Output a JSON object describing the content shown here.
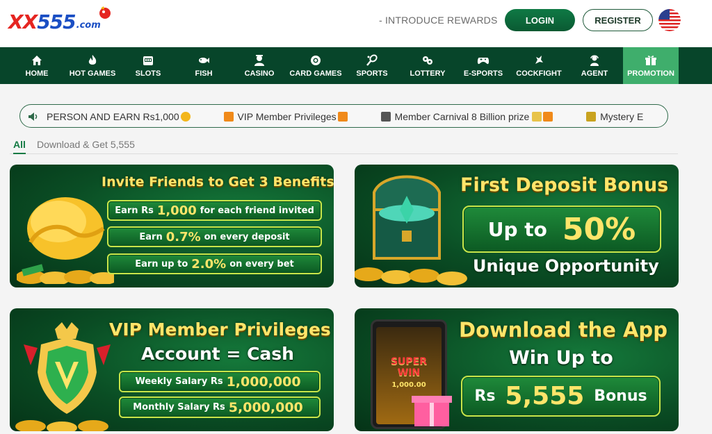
{
  "header": {
    "logo": {
      "xx": "XX",
      "num": "555",
      "com": ".com"
    },
    "intro_rewards": "- INTRODUCE REWARDS",
    "login_label": "LOGIN",
    "register_label": "REGISTER"
  },
  "nav": {
    "items": [
      {
        "label": "HOME",
        "icon": "home-icon"
      },
      {
        "label": "HOT GAMES",
        "icon": "flame-icon"
      },
      {
        "label": "SLOTS",
        "icon": "slot-machine-icon"
      },
      {
        "label": "FISH",
        "icon": "fish-icon"
      },
      {
        "label": "CASINO",
        "icon": "dealer-icon"
      },
      {
        "label": "CARD GAMES",
        "icon": "poker-chip-icon"
      },
      {
        "label": "SPORTS",
        "icon": "racket-icon"
      },
      {
        "label": "LOTTERY",
        "icon": "lottery-balls-icon"
      },
      {
        "label": "E-SPORTS",
        "icon": "gamepad-icon"
      },
      {
        "label": "COCKFIGHT",
        "icon": "rooster-icon"
      },
      {
        "label": "AGENT",
        "icon": "agent-icon"
      },
      {
        "label": "PROMOTION",
        "icon": "gift-icon"
      }
    ],
    "active": "PROMOTION"
  },
  "marquee": {
    "items": [
      "PERSON AND EARN Rs1,000",
      "VIP Member Privileges",
      "Member Carnival 8 Billion prize",
      "Mystery E"
    ]
  },
  "tabs": {
    "all": "All",
    "download": "Download & Get 5,555"
  },
  "cards": {
    "invite": {
      "title": "Invite Friends to Get 3 Benefits",
      "row1_pre": "Earn Rs",
      "row1_big": "1,000",
      "row1_post": "for each friend invited",
      "row2_pre": "Earn",
      "row2_big": "0.7%",
      "row2_post": "on every deposit",
      "row3_pre": "Earn up to",
      "row3_big": "2.0%",
      "row3_post": "on every bet"
    },
    "deposit": {
      "title": "First Deposit Bonus",
      "up_to": "Up to",
      "percent": "50%",
      "tagline": "Unique Opportunity"
    },
    "vip": {
      "title": "VIP Member Privileges",
      "subtitle": "Account = Cash",
      "row1_pre": "Weekly Salary Rs",
      "row1_big": "1,000,000",
      "row2_pre": "Monthly Salary Rs",
      "row2_big": "5,000,000"
    },
    "app": {
      "title": "Download the App",
      "subtitle": "Win Up to",
      "rs": "Rs",
      "amount": "5,555",
      "bonus": "Bonus",
      "phone_text": "SUPER WIN",
      "phone_amount": "1,000.00"
    }
  },
  "colors": {
    "nav_bg": "#07452a",
    "nav_active": "#3fae6c",
    "accent_green": "#0f7a45",
    "gold": "#ffe56a"
  }
}
